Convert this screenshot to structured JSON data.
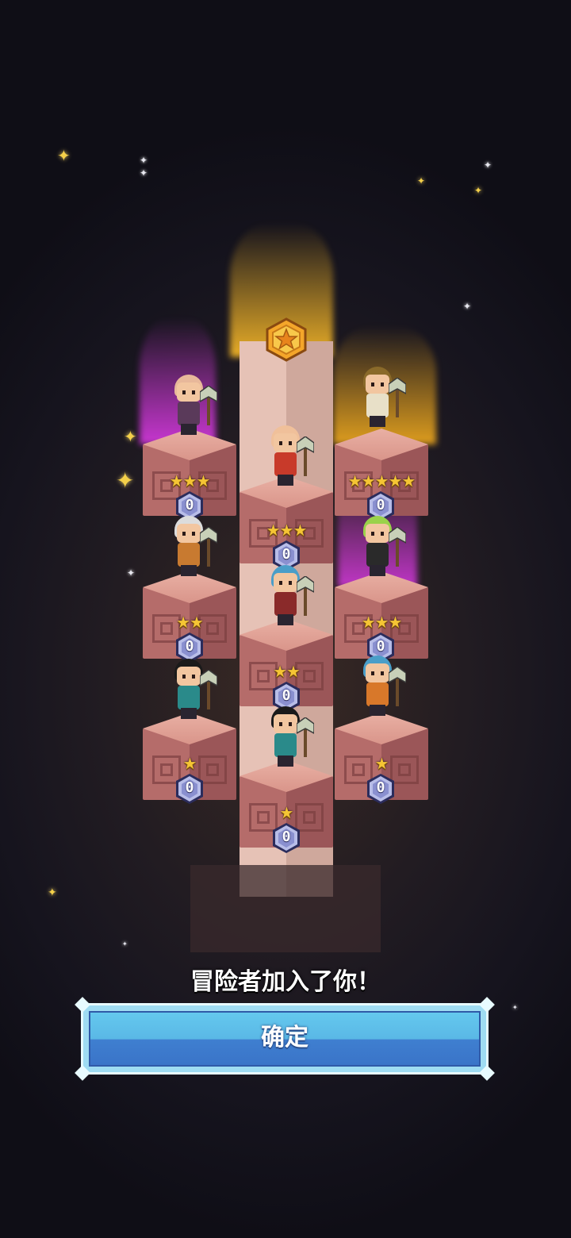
{
  "message": "冒险者加入了你！",
  "confirm_button": {
    "label": "确定"
  },
  "colors": {
    "background": "#16141e",
    "button_top": "#64c8ee",
    "button_bottom": "#3a74c8",
    "star": "#f5c534",
    "block": "#b56c6a"
  },
  "icons": {
    "medal": "star-medal-icon",
    "badge": "level-badge-icon",
    "star": "star-icon"
  },
  "heroes": [
    {
      "id": "bald-axe",
      "stars": "★★★",
      "level": "0",
      "hair": "#e8b89a",
      "outfit": "#5a3a5a",
      "glow": "purple"
    },
    {
      "id": "bald-hammer",
      "stars": "★★★",
      "level": "0",
      "hair": "#f0c09a",
      "outfit": "#c83a2a",
      "glow": "purple"
    },
    {
      "id": "flower-staff",
      "stars": "★★★★★",
      "level": "0",
      "hair": "#8a6a2a",
      "outfit": "#e8e0c8",
      "glow": "gold"
    },
    {
      "id": "silver-axe",
      "stars": "★★",
      "level": "0",
      "hair": "#dcdcdc",
      "outfit": "#c87a30",
      "glow": "none"
    },
    {
      "id": "blue-axe",
      "stars": "★★",
      "level": "0",
      "hair": "#4a9ec8",
      "outfit": "#8a2a2a",
      "glow": "none"
    },
    {
      "id": "green-axe",
      "stars": "★★★",
      "level": "0",
      "hair": "#9ad24a",
      "outfit": "#2a2a2a",
      "glow": "purple"
    },
    {
      "id": "black-bow",
      "stars": "★",
      "level": "0",
      "hair": "#1a1a1a",
      "outfit": "#2a8a8a",
      "glow": "none"
    },
    {
      "id": "black-sword",
      "stars": "★",
      "level": "0",
      "hair": "#1a1a1a",
      "outfit": "#2a8a8a",
      "glow": "none"
    },
    {
      "id": "blue-mace",
      "stars": "★",
      "level": "0",
      "hair": "#4a9ec8",
      "outfit": "#d8782a",
      "glow": "none"
    }
  ]
}
